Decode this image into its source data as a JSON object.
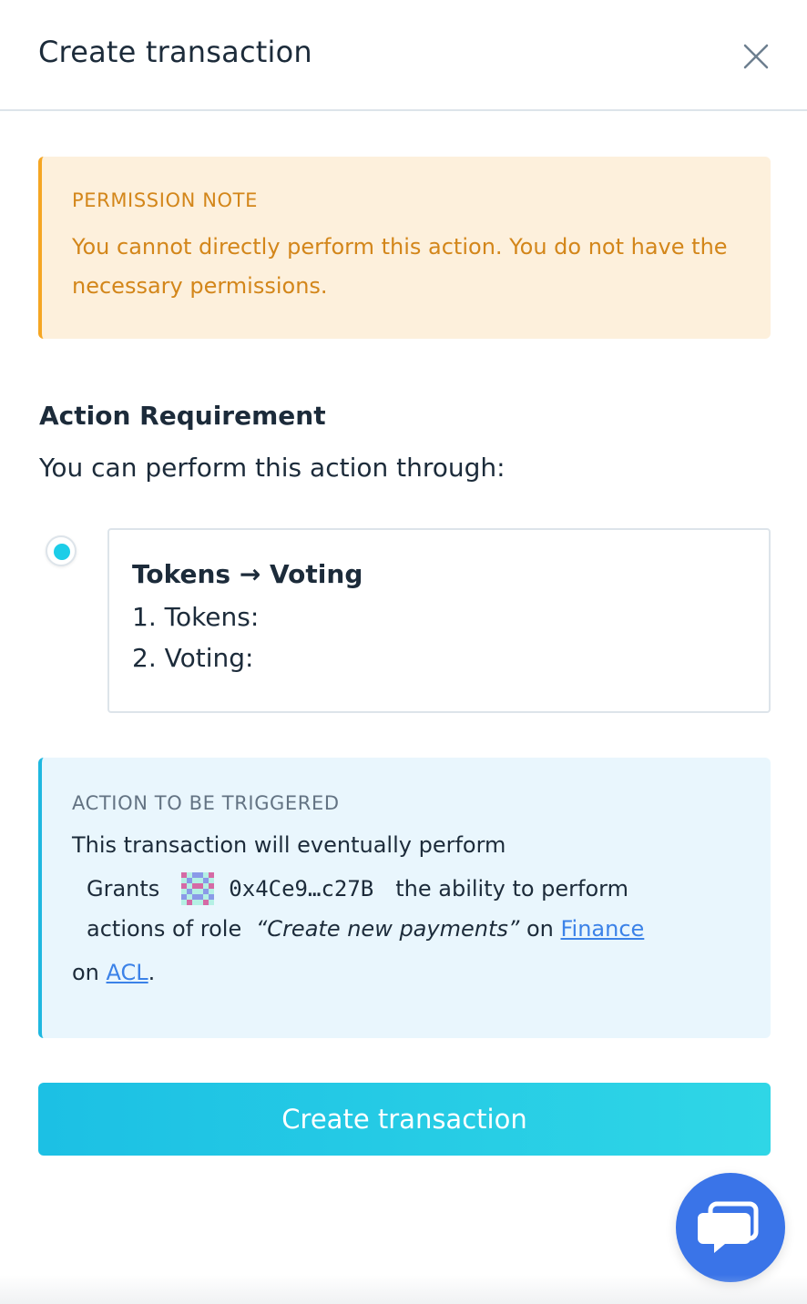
{
  "header": {
    "title": "Create transaction",
    "close_icon": "close-icon"
  },
  "permission_note": {
    "title": "PERMISSION NOTE",
    "text": "You cannot directly perform this action. You do not have the necessary permissions.",
    "accent": "#f5a623"
  },
  "requirement": {
    "heading": "Action Requirement",
    "subtitle": "You can perform this action through:",
    "paths": [
      {
        "selected": true,
        "title": "Tokens → Voting",
        "steps": [
          "1. Tokens:",
          "2. Voting:"
        ]
      }
    ]
  },
  "action": {
    "title": "ACTION TO BE TRIGGERED",
    "line1": "This transaction will eventually perform",
    "grants_label": "Grants",
    "address": "0x4Ce9…c27B",
    "ability_text": "the ability to perform",
    "role_prefix": "actions of role",
    "role_name": "“Create new payments”",
    "on_label": "on",
    "app_link": "Finance",
    "on_label2": "on",
    "acl_link": "ACL",
    "period": ".",
    "accent": "#1fb8e0"
  },
  "submit": {
    "label": "Create transaction"
  },
  "chat": {
    "icon": "chat-bubble-icon",
    "color": "#3a74e8"
  }
}
